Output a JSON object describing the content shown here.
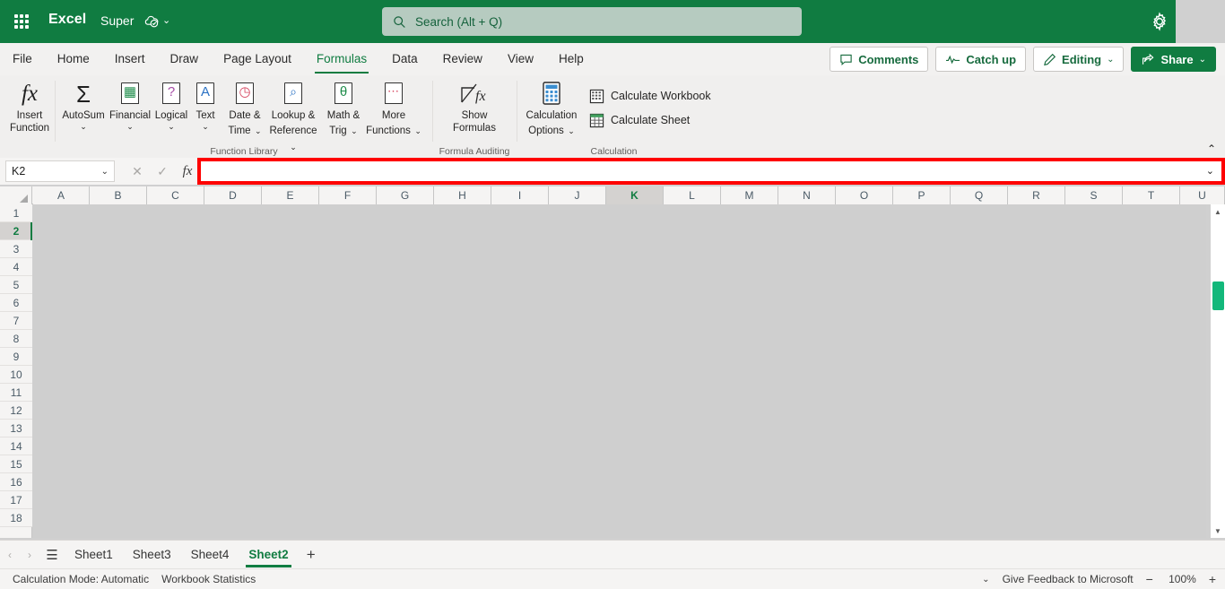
{
  "titlebar": {
    "app_launcher": "app-launcher",
    "brand": "Excel",
    "filename": "Super",
    "cloud_status_icon": "cloud-saved-icon",
    "file_chevron": "⌄",
    "settings_icon": "gear-icon"
  },
  "search": {
    "placeholder": "Search (Alt + Q)",
    "icon": "search-icon"
  },
  "ribbon_tabs": [
    {
      "label": "File",
      "active": false
    },
    {
      "label": "Home",
      "active": false
    },
    {
      "label": "Insert",
      "active": false
    },
    {
      "label": "Draw",
      "active": false
    },
    {
      "label": "Page Layout",
      "active": false
    },
    {
      "label": "Formulas",
      "active": true
    },
    {
      "label": "Data",
      "active": false
    },
    {
      "label": "Review",
      "active": false
    },
    {
      "label": "View",
      "active": false
    },
    {
      "label": "Help",
      "active": false
    }
  ],
  "right_actions": {
    "comments": "Comments",
    "catch_up": "Catch up",
    "editing": "Editing",
    "editing_chevron": "⌄",
    "share": "Share",
    "share_chevron": "⌄"
  },
  "ribbon": {
    "collapse_chevron": "⌃",
    "groups": [
      {
        "label": "Function Library"
      },
      {
        "label": "Formula Auditing"
      },
      {
        "label": "Calculation"
      }
    ],
    "insert_function": {
      "label_line1": "Insert",
      "label_line2": "Function",
      "icon": "fx-icon"
    },
    "autosum": {
      "label": "AutoSum",
      "icon": "sigma-icon",
      "chevron": "⌄"
    },
    "financial": {
      "label": "Financial",
      "icon": "financial-book-icon",
      "glyph": "▤",
      "chevron": "⌄"
    },
    "logical": {
      "label": "Logical",
      "icon": "logical-book-icon",
      "glyph": "?",
      "chevron": "⌄"
    },
    "text": {
      "label": "Text",
      "icon": "text-book-icon",
      "glyph": "A",
      "chevron": "⌄"
    },
    "date_time": {
      "label_line1": "Date &",
      "label_line2": "Time",
      "icon": "clock-book-icon",
      "glyph": "◷",
      "chevron": "⌄"
    },
    "lookup_reference": {
      "label_line1": "Lookup &",
      "label_line2": "Reference",
      "icon": "lookup-book-icon",
      "glyph": "⌕",
      "chevron": "⌄"
    },
    "math_trig": {
      "label_line1": "Math &",
      "label_line2": "Trig",
      "icon": "math-book-icon",
      "glyph": "θ",
      "chevron": "⌄"
    },
    "more_functions": {
      "label_line1": "More",
      "label_line2": "Functions",
      "icon": "more-functions-book-icon",
      "glyph": "⋯",
      "chevron": "⌄"
    },
    "show_formulas": {
      "label_line1": "Show",
      "label_line2": "Formulas",
      "icon": "show-formulas-icon"
    },
    "calculation_options": {
      "label_line1": "Calculation",
      "label_line2": "Options",
      "icon": "calculator-icon",
      "chevron": "⌄"
    },
    "calculate_workbook": {
      "label": "Calculate Workbook",
      "icon": "calculate-workbook-icon"
    },
    "calculate_sheet": {
      "label": "Calculate Sheet",
      "icon": "calculate-sheet-icon"
    }
  },
  "formula_bar": {
    "name_box_value": "K2",
    "name_box_chevron": "⌄",
    "cancel_icon": "✕",
    "enter_icon": "✓",
    "fx_icon": "fx",
    "value": "",
    "placeholder": "",
    "expand_chevron": "⌄",
    "highlight_color": "#fe0000"
  },
  "grid": {
    "columns": [
      "A",
      "B",
      "C",
      "D",
      "E",
      "F",
      "G",
      "H",
      "I",
      "J",
      "K",
      "L",
      "M",
      "N",
      "O",
      "P",
      "Q",
      "R",
      "S",
      "T",
      "U"
    ],
    "rows": [
      "1",
      "2",
      "3",
      "4",
      "5",
      "6",
      "7",
      "8",
      "9",
      "10",
      "11",
      "12",
      "13",
      "14",
      "15",
      "16",
      "17",
      "18"
    ],
    "selected_column": "K",
    "selected_row": "2",
    "selected_cell": "K2",
    "select_all_icon": "select-all-triangle-icon",
    "scrollbar": {
      "up_arrow": "▲",
      "down_arrow": "▼",
      "thumb_color": "#13b87b"
    }
  },
  "sheet_tabs": {
    "prev_icon": "‹",
    "next_icon": "›",
    "list_icon": "☰",
    "add_icon": "+",
    "tabs": [
      {
        "label": "Sheet1",
        "active": false
      },
      {
        "label": "Sheet3",
        "active": false
      },
      {
        "label": "Sheet4",
        "active": false
      },
      {
        "label": "Sheet2",
        "active": true
      }
    ]
  },
  "status_bar": {
    "calculation_mode": "Calculation Mode: Automatic",
    "workbook_statistics": "Workbook Statistics",
    "options_chevron": "⌄",
    "feedback": "Give Feedback to Microsoft",
    "zoom_out": "−",
    "zoom_level": "100%",
    "zoom_in": "+"
  }
}
